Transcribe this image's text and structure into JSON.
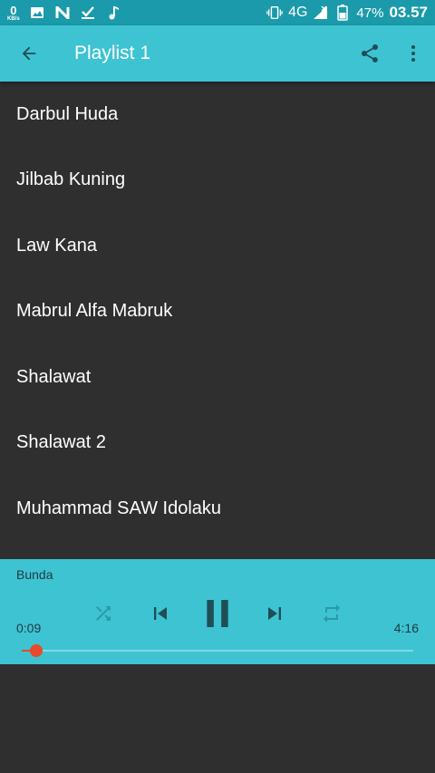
{
  "status_bar": {
    "speed_value": "0",
    "speed_unit": "KB/s",
    "network": "4G",
    "battery": "47%",
    "time": "03.57",
    "icons": [
      "image-icon",
      "n-icon",
      "check-icon",
      "music-note-icon",
      "vibrate-icon",
      "signal-icon",
      "battery-icon"
    ]
  },
  "app_bar": {
    "title": "Playlist 1",
    "icons": [
      "back-arrow-icon",
      "share-icon",
      "more-vert-icon"
    ]
  },
  "playlist": {
    "items": [
      {
        "title": "Darbul Huda"
      },
      {
        "title": "Jilbab Kuning"
      },
      {
        "title": "Law Kana"
      },
      {
        "title": "Mabrul Alfa Mabruk"
      },
      {
        "title": "Shalawat"
      },
      {
        "title": "Shalawat 2"
      },
      {
        "title": "Muhammad SAW Idolaku"
      }
    ]
  },
  "player": {
    "now_playing": "Bunda",
    "current_time": "0:09",
    "total_time": "4:16",
    "progress": 0.036,
    "state": "playing",
    "controls": [
      "shuffle-icon",
      "skip-previous-icon",
      "pause-icon",
      "skip-next-icon",
      "repeat-icon"
    ]
  },
  "colors": {
    "status_bar": "#1a9aaa",
    "accent": "#3ec3d3",
    "background": "#2f2f2f",
    "seek_thumb": "#e84a2c",
    "control_dark": "#1f4e56",
    "control_muted": "#2a9aa6"
  }
}
